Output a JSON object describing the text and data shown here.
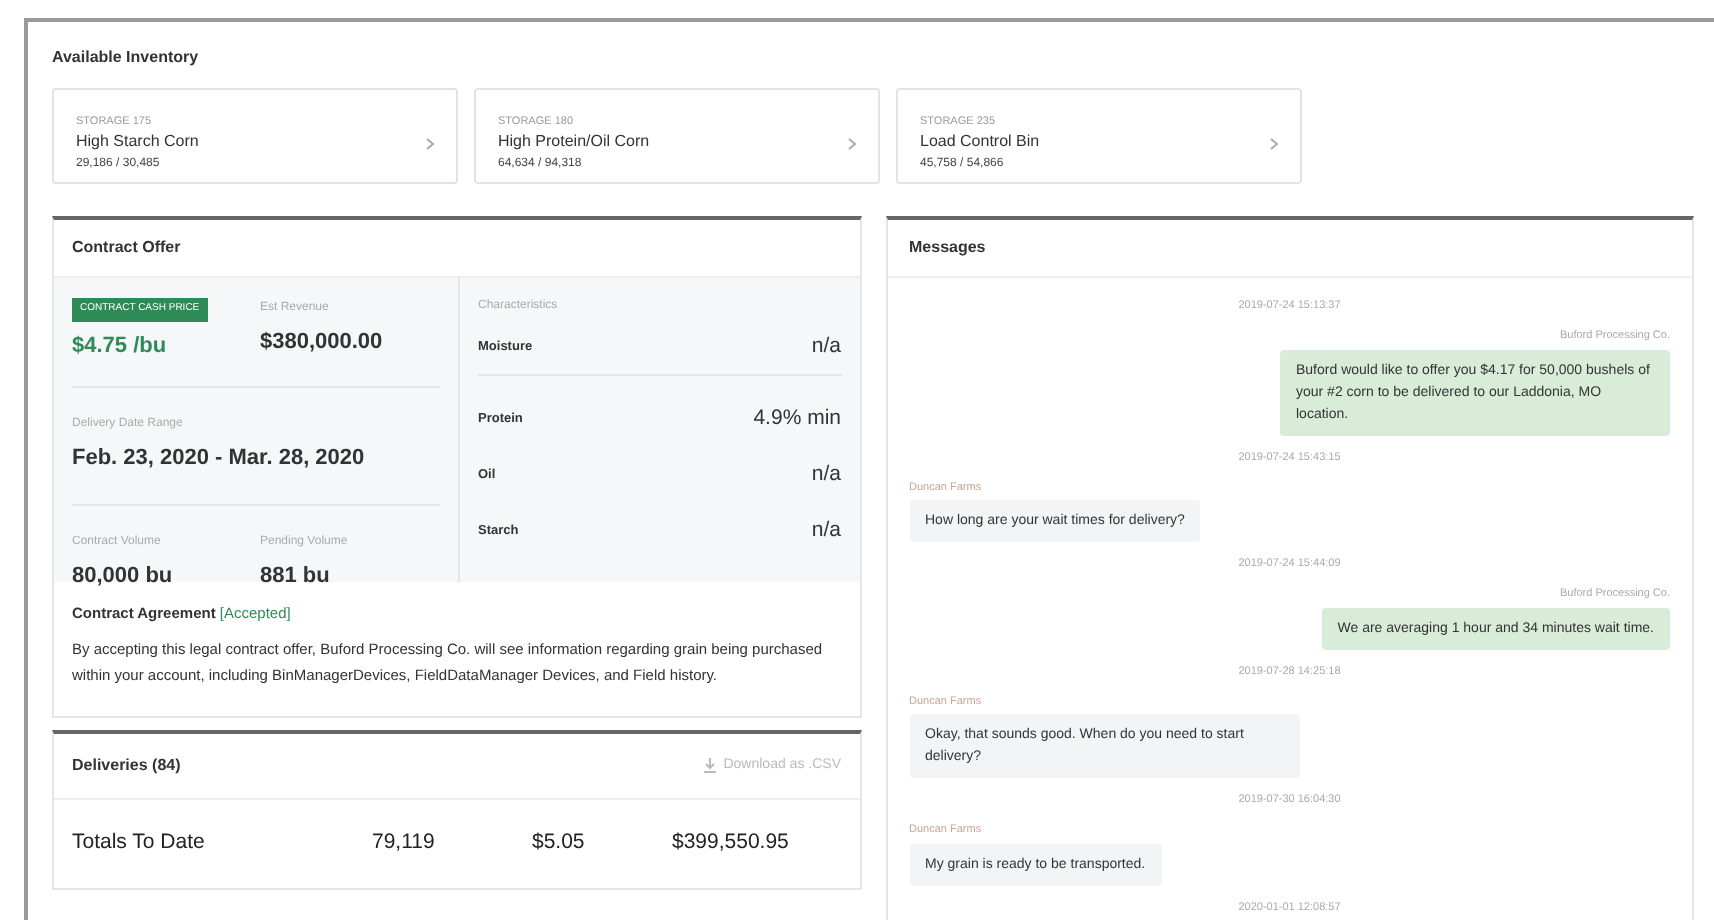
{
  "inventory": {
    "title": "Available Inventory",
    "cards": [
      {
        "storage": "STORAGE 175",
        "name": "High Starch Corn",
        "amount": "29,186 / 30,485"
      },
      {
        "storage": "STORAGE 180",
        "name": "High Protein/Oil Corn",
        "amount": "64,634 / 94,318"
      },
      {
        "storage": "STORAGE 235",
        "name": "Load Control Bin",
        "amount": "45,758 / 54,866"
      }
    ]
  },
  "contract_offer": {
    "title": "Contract Offer",
    "price_badge": "CONTRACT CASH PRICE",
    "price": "$4.75 /bu",
    "revenue_label": "Est Revenue",
    "revenue": "$380,000.00",
    "date_label": "Delivery Date Range",
    "date_range": "Feb. 23, 2020 - Mar. 28, 2020",
    "volume_label": "Contract Volume",
    "volume": "80,000 bu",
    "pending_label": "Pending Volume",
    "pending": "881 bu",
    "characteristics_label": "Characteristics",
    "characteristics": [
      {
        "name": "Moisture",
        "value": "n/a"
      },
      {
        "name": "Protein",
        "value": "4.9% min"
      },
      {
        "name": "Oil",
        "value": "n/a"
      },
      {
        "name": "Starch",
        "value": "n/a"
      }
    ],
    "agreement_title": "Contract Agreement",
    "agreement_status": "[Accepted]",
    "agreement_text": "By accepting this legal contract offer, Buford Processing Co. will see information regarding grain being purchased within your account, including BinManagerDevices, FieldDataManager Devices, and Field history."
  },
  "deliveries": {
    "title": "Deliveries (84)",
    "download": "Download as .CSV",
    "totals": [
      "Totals To Date",
      "79,119",
      "$5.05",
      "$399,550.95"
    ]
  },
  "messages": {
    "title": "Messages",
    "items": [
      {
        "kind": "timestamp",
        "text": "2019-07-24 15:13:37"
      },
      {
        "kind": "outgoing",
        "sender": "Buford Processing Co.",
        "text": "Buford would like to offer you $4.17 for 50,000 bushels of your #2 corn to be delivered to our Laddonia, MO location."
      },
      {
        "kind": "timestamp",
        "text": "2019-07-24 15:43:15"
      },
      {
        "kind": "incoming",
        "sender": "Duncan Farms",
        "text": "How long are your wait times for delivery?"
      },
      {
        "kind": "timestamp",
        "text": "2019-07-24 15:44:09"
      },
      {
        "kind": "outgoing",
        "sender": "Buford Processing Co.",
        "text": "We are averaging 1 hour and 34 minutes wait time."
      },
      {
        "kind": "timestamp",
        "text": "2019-07-28 14:25:18"
      },
      {
        "kind": "incoming",
        "sender": "Duncan Farms",
        "text": "Okay, that sounds good. When do you need to start delivery?"
      },
      {
        "kind": "timestamp",
        "text": "2019-07-30 16:04:30"
      },
      {
        "kind": "incoming",
        "sender": "Duncan Farms",
        "text": "My grain is ready to be transported."
      },
      {
        "kind": "timestamp",
        "text": "2020-01-01 12:08:57"
      }
    ]
  }
}
